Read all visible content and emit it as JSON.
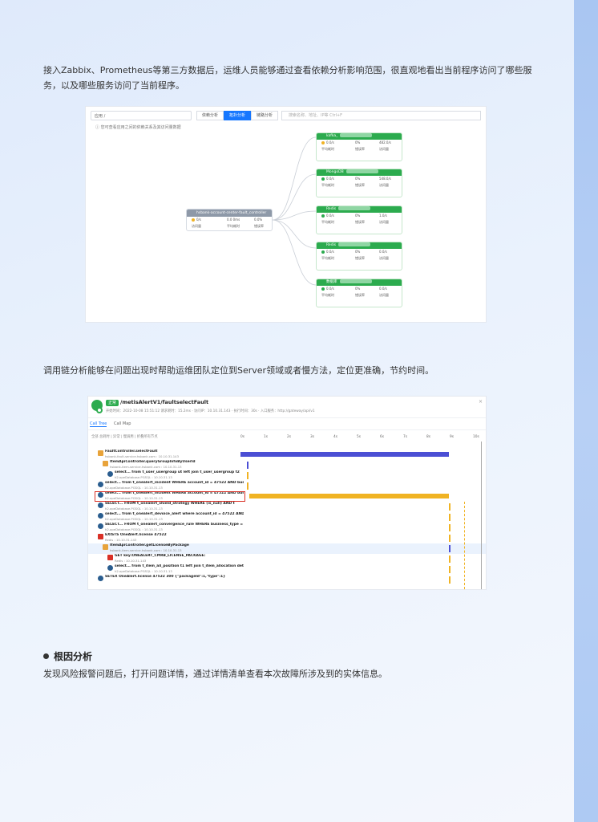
{
  "intro": {
    "text": "接入Zabbix、Prometheus等第三方数据后，运维人员能够通过查看依赖分析影响范围，很直观地看出当前程序访问了哪些服务，以及哪些服务访问了当前程序。"
  },
  "dep_view": {
    "select_label": "应用 / ",
    "segments": [
      "依赖分析",
      "拓扑分析",
      "链路分析"
    ],
    "search_placeholder": "搜索名称、地址、IP等 Ctrl+F",
    "tip": "您可查看应用之间的依赖关系及其访问量数据",
    "center_node": {
      "title": "hsbank-account-center-fault_controller",
      "stats": [
        "访问量",
        "平均耗时",
        "错误率"
      ],
      "values": [
        "0/s",
        "0.0 0ms",
        "0.0%"
      ]
    },
    "nodes": [
      {
        "name": "kafka_",
        "row1": [
          "0.0/s",
          "0%",
          "482.0/s"
        ],
        "row2": [
          "平均耗时",
          "错误率",
          "访问量"
        ]
      },
      {
        "name": "MongoDB",
        "row1": [
          "0.0/s",
          "0%",
          "548.0/s"
        ],
        "row2": [
          "平均耗时",
          "错误率",
          "访问量"
        ]
      },
      {
        "name": "Redis",
        "row1": [
          "0.0/s",
          "0%",
          "1.0/s"
        ],
        "row2": [
          "平均耗时",
          "错误率",
          "访问量"
        ]
      },
      {
        "name": "Redis",
        "row1": [
          "0.0/s",
          "0%",
          "0.0/s"
        ],
        "row2": [
          "平均耗时",
          "错误率",
          "访问量"
        ]
      },
      {
        "name": "数据库",
        "row1": [
          "0.0/s",
          "0%",
          "0.0/s"
        ],
        "row2": [
          "平均耗时",
          "错误率",
          "访问量"
        ]
      }
    ]
  },
  "trace_text": "调用链分析能够在问题出现时帮助运维团队定位到Server领域或者慢方法，定位更准确，节约时间。",
  "trace_view": {
    "tag": "正常",
    "title": "/metisAlertV1/faultselectFault",
    "meta": "开始时间：2022-10-08 15:51:12   请求耗时：15.2ms   ·   访问IP：10.10.31.143   ·   执行时间：30s   ·   入口服务：http://gateway/api/v1",
    "close": "×",
    "tabs": [
      "Call Tree",
      "Call Map"
    ],
    "filter": "全部  总耗时  |  异常  |  慢调用          |  折叠所有节点",
    "axis_ticks": [
      "0s",
      "1s",
      "2s",
      "3s",
      "4s",
      "5s",
      "6s",
      "7s",
      "8s",
      "9s",
      "10s"
    ],
    "rows": [
      {
        "name": "FaultController.selectFault",
        "sub": "hsbank-fault-service.hsbank.com : 10.10.31.143",
        "icon": "spring",
        "indent": 12,
        "bar": [
          0.0,
          0.93
        ],
        "color": "#4b4fd4"
      },
      {
        "name": "ItemApiController.queryGroupInfoByUserId",
        "sub": "hsbank-item-service.hsbank.com : 10.10.31.13",
        "icon": "spring",
        "indent": 18,
        "bar": [
          0.03,
          0.005
        ],
        "color": "#4b4fd4"
      },
      {
        "name": "select... from t_user_usergroup ut left join t_user_usergroup t2",
        "sub": "h2.opeDatabase.PGSQL : 10.10.31.13",
        "icon": "db",
        "indent": 24,
        "bar": [
          0.03,
          0.005
        ],
        "color": "#f0b323"
      },
      {
        "name": "select... from t_onealert_incident WHERE account_id = 47522 AND bus",
        "sub": "h2.opeDatabase.PGSQL : 10.10.31.13",
        "icon": "db",
        "indent": 12,
        "bar": [
          0.03,
          0.005
        ],
        "color": "#f0b323"
      },
      {
        "name": "select... from t_onealert_incident WHERE account_id = 47522 AND bus",
        "sub": "h2.opeDatabase.PGSQL : 10.10.31.13",
        "icon": "db",
        "indent": 12,
        "bar": [
          0.04,
          0.89
        ],
        "color": "#f0b323"
      },
      {
        "name": "SELECT... FROM t_onealert_shield_strategy WHERE (is_null) AND t",
        "sub": "h2.opeDatabase.PGSQL : 10.10.31.13",
        "icon": "db",
        "indent": 12,
        "bar": [
          0.93,
          0.005
        ],
        "color": "#f0b323"
      },
      {
        "name": "select... from t_onealert_devoice_alert where account_id = 47522 AND",
        "sub": "h2.opeDatabase.PGSQL : 10.10.31.13",
        "icon": "db",
        "indent": 12,
        "bar": [
          0.93,
          0.005
        ],
        "color": "#f0b323"
      },
      {
        "name": "SELECT... FROM t_onealert_convergence_rule WHERE business_type =",
        "sub": "h2.opeDatabase.PGSQL : 10.10.31.13",
        "icon": "db",
        "indent": 12,
        "bar": [
          0.93,
          0.005
        ],
        "color": "#f0b323"
      },
      {
        "name": "EXISTS OneAlert.license 47522",
        "sub": "Redis : 10.10.31.143",
        "icon": "redis",
        "indent": 12,
        "bar": [
          0.93,
          0.005
        ],
        "color": "#f0b323"
      },
      {
        "name": "ItemApiController.getLicenseByPackage",
        "sub": "hsbank-item-service.hsbank.com : 10.10.31.13",
        "icon": "spring",
        "indent": 18,
        "bar": [
          0.93,
          0.005
        ],
        "color": "#4b4fd4"
      },
      {
        "name": "GET key:ONEALERT_CMRB_LICENSE_PACKAGE:",
        "sub": "Redis : 10.10.31.143",
        "icon": "redis",
        "indent": 24,
        "bar": [
          0.93,
          0.005
        ],
        "color": "#f0b323"
      },
      {
        "name": "select... from t_item_all_position t1 left join t_item_allocation detail t",
        "sub": "h2.opeDatabase.PGSQL : 10.10.31.13",
        "icon": "db",
        "indent": 24,
        "bar": [
          0.93,
          0.005
        ],
        "color": "#f0b323"
      },
      {
        "name": "SETEX OneAlert.license 47522 300 {\"packageId\":1,\"type\":1}",
        "sub": "",
        "icon": "db",
        "indent": 12,
        "bar": [
          0.93,
          0.005
        ],
        "color": "#f0b323"
      }
    ]
  },
  "section": {
    "title": "根因分析",
    "text": "发现风险报警问题后，打开问题详情，通过详情清单查看本次故障所涉及到的实体信息。"
  }
}
